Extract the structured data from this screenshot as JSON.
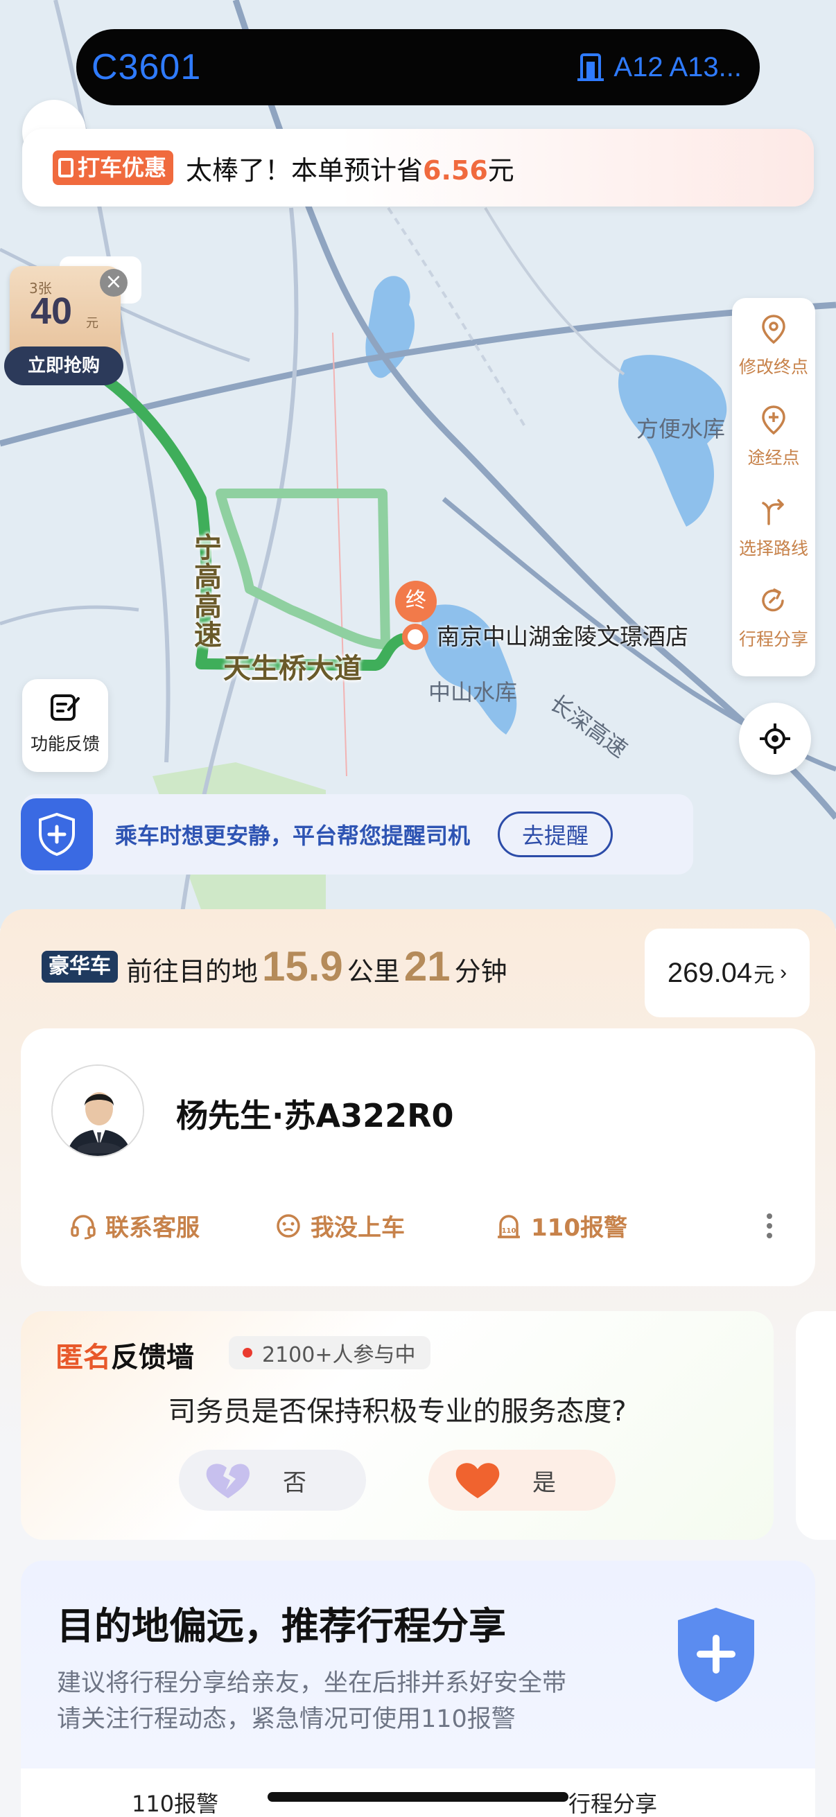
{
  "status_island": {
    "flight_number": "C3601",
    "gate_text": "A12 A13..."
  },
  "promo": {
    "tag": "打车优惠",
    "text_prefix": "太棒了！本单预计省",
    "amount": "6.56",
    "text_suffix": "元"
  },
  "coupon": {
    "count": "3张",
    "value": "40",
    "unit": "元",
    "buy_label": "立即抢购"
  },
  "side_panel": {
    "items": [
      {
        "label": "修改终点",
        "icon": "location-pin-icon"
      },
      {
        "label": "途经点",
        "icon": "add-waypoint-icon"
      },
      {
        "label": "选择路线",
        "icon": "route-fork-icon"
      },
      {
        "label": "行程分享",
        "icon": "share-trip-icon"
      }
    ]
  },
  "map": {
    "labels": {
      "reservoir_east": "方便水库",
      "reservoir_center": "中山水库",
      "expressway_vertical": "宁高高速",
      "avenue": "天生桥大道",
      "expressway_diag": "长深高速",
      "destination": "南京中山湖金陵文璟酒店",
      "end_marker": "终"
    },
    "route_color": "#3fae5a",
    "alt_route_color": "#8fd0a0"
  },
  "feedback_button": {
    "label": "功能反馈"
  },
  "quiet_banner": {
    "text": "乘车时想更安静，平台帮您提醒司机",
    "button": "去提醒"
  },
  "trip": {
    "car_type": "豪华车",
    "prefix": "前往目的地",
    "distance": "15.9",
    "distance_unit": "公里",
    "duration": "21",
    "duration_unit": "分钟",
    "price": "269.04",
    "price_unit": "元",
    "price_arrow": "›"
  },
  "driver": {
    "name_plate": "杨先生·苏A322R0",
    "actions": [
      {
        "label": "联系客服",
        "icon": "headset-icon"
      },
      {
        "label": "我没上车",
        "icon": "face-icon"
      },
      {
        "label": "110报警",
        "icon": "police-icon"
      }
    ]
  },
  "feedback_wall": {
    "title_highlight": "匿名",
    "title_rest": "反馈墙",
    "participants": "2100+人参与中",
    "question": "司务员是否保持积极专业的服务态度?",
    "no_label": "否",
    "yes_label": "是"
  },
  "share_card": {
    "title": "目的地偏远，推荐行程分享",
    "line1": "建议将行程分享给亲友，坐在后排并系好安全带",
    "line2": "请关注行程动态，紧急情况可使用110报警",
    "bottom_left": "110报警",
    "bottom_right": "行程分享"
  },
  "colors": {
    "accent_orange": "#f06a3e",
    "brand_gold": "#c7824a",
    "safety_blue": "#3a6ae3",
    "island_text": "#2f7bff"
  }
}
